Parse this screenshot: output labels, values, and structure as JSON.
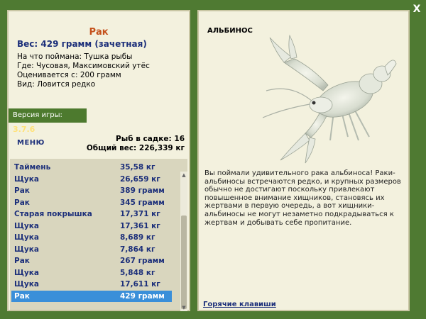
{
  "window": {
    "close_label": "X"
  },
  "fish": {
    "name": "Рак",
    "weight": "Вес: 429 грамм (зачетная)",
    "bait": "На что поймана: Тушка рыбы",
    "location": "Где: Чусовая, Максимовский утёс",
    "value": "Оценивается с: 200 грамм",
    "rarity": "Вид: Ловится редко"
  },
  "version": {
    "label": "Версия игры:",
    "number": "3.7.6"
  },
  "menu": {
    "label": "МЕНЮ"
  },
  "stats": {
    "count": "Рыб в садке: 16",
    "total": "Общий вес: 226,339 кг"
  },
  "catch_list": [
    {
      "name": "Таймень",
      "weight": "35,58 кг"
    },
    {
      "name": "Щука",
      "weight": "26,659 кг"
    },
    {
      "name": "Рак",
      "weight": "389 грамм"
    },
    {
      "name": "Рак",
      "weight": "345 грамм"
    },
    {
      "name": "Старая покрышка",
      "weight": "17,371 кг"
    },
    {
      "name": "Щука",
      "weight": "17,361 кг"
    },
    {
      "name": "Щука",
      "weight": "8,689 кг"
    },
    {
      "name": "Щука",
      "weight": "7,864 кг"
    },
    {
      "name": "Рак",
      "weight": "267 грамм"
    },
    {
      "name": "Щука",
      "weight": "5,848 кг"
    },
    {
      "name": "Щука",
      "weight": "17,611 кг"
    },
    {
      "name": "Рак",
      "weight": "429 грамм"
    }
  ],
  "selected_index": 11,
  "right": {
    "title": "АЛЬБИНОС",
    "description": "Вы поймали удивительного рака альбиноса! Раки-альбиносы встречаются редко, и крупных размеров обычно не достигают поскольку привлекают повышенное внимание хищников, становясь их жертвами в первую очередь, а вот хищники-альбиносы не могут незаметно подкрадываться к жертвам и добывать себе пропитание.",
    "hotkeys": "Горячие клавиши",
    "image": "albino-crayfish-image"
  },
  "colors": {
    "frame": "#4f7a32",
    "panel": "#f3f1de",
    "selected": "#3a8fd9",
    "accent": "#c4501a"
  }
}
